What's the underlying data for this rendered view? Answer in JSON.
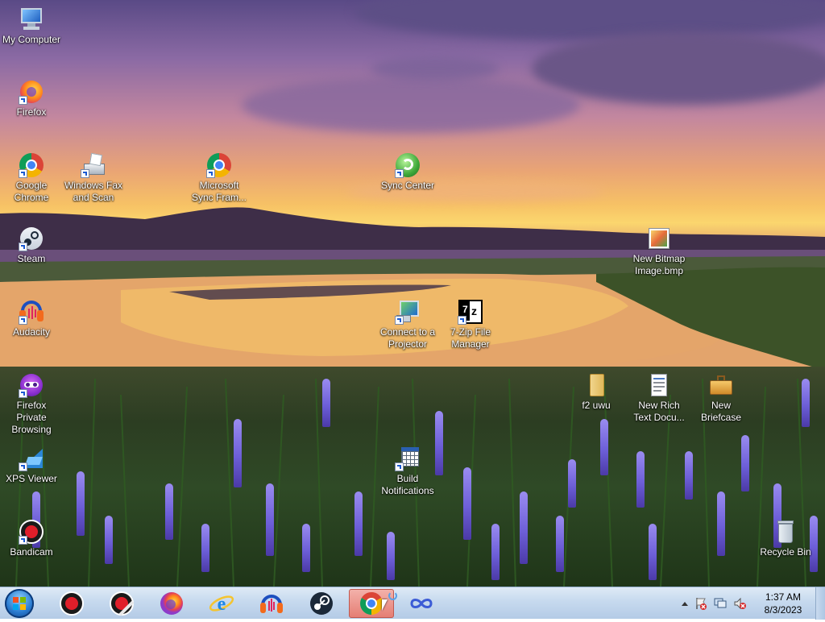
{
  "desktop_icons": [
    {
      "id": "my-computer",
      "label": "My Computer",
      "icon": "computer-icon"
    },
    {
      "id": "firefox",
      "label": "Firefox",
      "icon": "firefox-icon"
    },
    {
      "id": "google-chrome",
      "label": "Google\nChrome",
      "icon": "chrome-icon"
    },
    {
      "id": "windows-fax",
      "label": "Windows Fax\nand Scan",
      "icon": "fax-scanner-icon"
    },
    {
      "id": "ms-sync",
      "label": "Microsoft\nSync Fram...",
      "icon": "chrome-icon"
    },
    {
      "id": "sync-center",
      "label": "Sync Center",
      "icon": "sync-icon"
    },
    {
      "id": "steam",
      "label": "Steam",
      "icon": "steam-icon"
    },
    {
      "id": "new-bitmap",
      "label": "New Bitmap\nImage.bmp",
      "icon": "bitmap-icon"
    },
    {
      "id": "audacity",
      "label": "Audacity",
      "icon": "audacity-icon"
    },
    {
      "id": "connect-projector",
      "label": "Connect to a\nProjector",
      "icon": "projector-icon"
    },
    {
      "id": "seven-zip",
      "label": "7-Zip File\nManager",
      "icon": "seven-zip-icon"
    },
    {
      "id": "firefox-private",
      "label": "Firefox Private\nBrowsing",
      "icon": "firefox-private-icon"
    },
    {
      "id": "f2-uwu",
      "label": "f2 uwu",
      "icon": "folder-icon"
    },
    {
      "id": "new-rich-text",
      "label": "New Rich\nText Docu...",
      "icon": "document-icon"
    },
    {
      "id": "new-briefcase",
      "label": "New Briefcase",
      "icon": "briefcase-icon"
    },
    {
      "id": "xps-viewer",
      "label": "XPS Viewer",
      "icon": "xps-icon"
    },
    {
      "id": "build-notifications",
      "label": "Build\nNotifications",
      "icon": "build-icon"
    },
    {
      "id": "bandicam",
      "label": "Bandicam",
      "icon": "bandicam-icon"
    },
    {
      "id": "recycle-bin",
      "label": "Recycle Bin",
      "icon": "recycle-bin-icon"
    }
  ],
  "taskbar": {
    "start_icon": "windows-start-icon",
    "pinned": [
      {
        "id": "bandicam",
        "icon": "bandicam-record-icon",
        "active": false
      },
      {
        "id": "bandicut",
        "icon": "bandicut-icon",
        "active": false
      },
      {
        "id": "firefox",
        "icon": "firefox-icon",
        "active": false
      },
      {
        "id": "internet-explorer",
        "icon": "internet-explorer-icon",
        "active": false
      },
      {
        "id": "audacity",
        "icon": "audacity-icon",
        "active": false
      },
      {
        "id": "steam",
        "icon": "steam-icon",
        "active": false
      },
      {
        "id": "chrome",
        "icon": "chrome-icon",
        "active": true
      },
      {
        "id": "sync-framework",
        "icon": "infinity-icon",
        "active": false
      }
    ],
    "tray": {
      "icons": [
        "show-hidden-icons-chevron",
        "action-center-flag-icon",
        "network-icon",
        "volume-muted-icon"
      ],
      "time": "1:37 AM",
      "date": "8/3/2023"
    }
  }
}
